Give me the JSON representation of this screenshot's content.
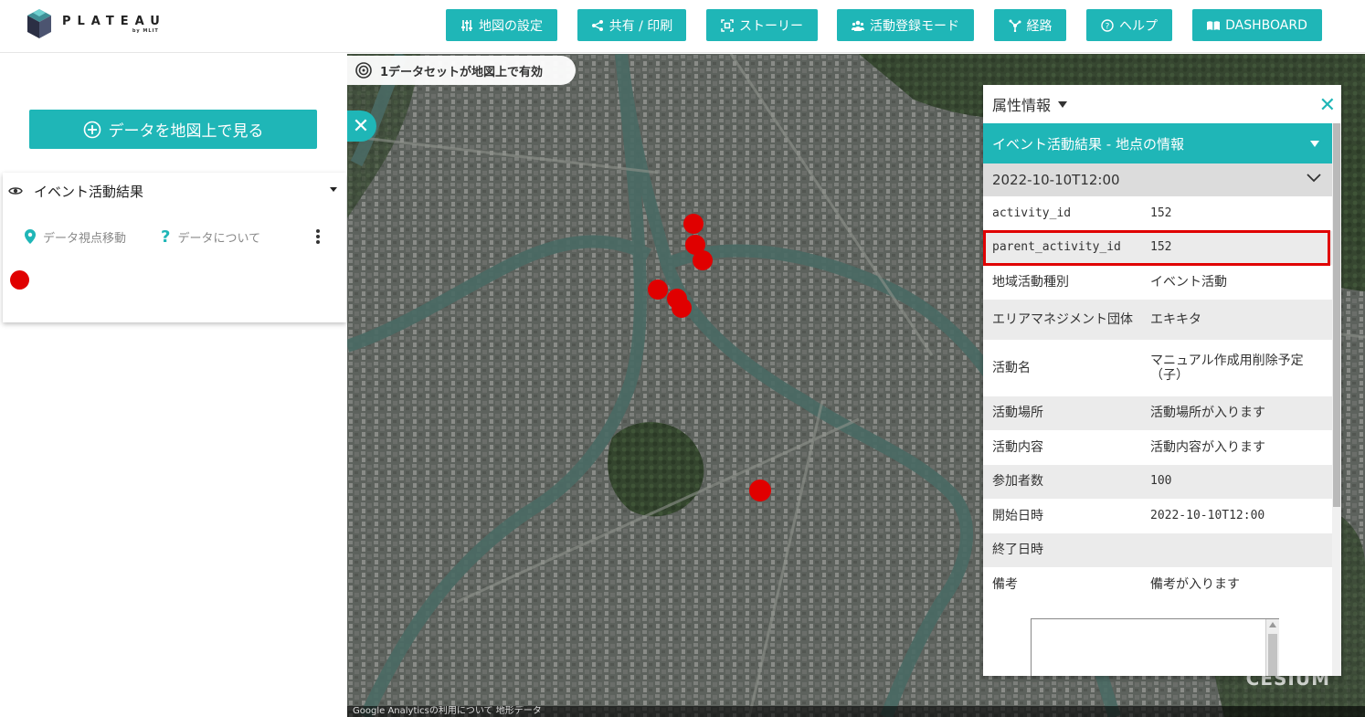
{
  "header": {
    "logo_title": "PLATEAU",
    "logo_sub": "by MLIT",
    "nav": [
      {
        "label": "地図の設定",
        "icon": "sliders-icon"
      },
      {
        "label": "共有 / 印刷",
        "icon": "share-icon"
      },
      {
        "label": "ストーリー",
        "icon": "story-icon"
      },
      {
        "label": "活動登録モード",
        "icon": "people-icon"
      },
      {
        "label": "経路",
        "icon": "route-icon"
      },
      {
        "label": "ヘルプ",
        "icon": "help-circle-icon"
      },
      {
        "label": "DASHBOARD",
        "icon": "book-icon"
      }
    ]
  },
  "left_panel": {
    "add_data_label": "データを地図上で見る",
    "dataset": {
      "title": "イベント活動結果",
      "actions": [
        {
          "label": "データ視点移動",
          "icon": "location-pin-icon"
        },
        {
          "label": "データについて",
          "icon": "question-icon"
        }
      ],
      "legend_color": "#e00000"
    }
  },
  "map": {
    "dataset_status": "1データセットが地図上で有効",
    "attribution": "Google Analyticsの利用について 地形データ",
    "cesium_label": "CESIUM"
  },
  "attribute_panel": {
    "title": "属性情報",
    "layer_title": "イベント活動結果 - 地点の情報",
    "timestamp": "2022-10-10T12:00",
    "rows": [
      {
        "key": "activity_id",
        "value": "152"
      },
      {
        "key": "parent_activity_id",
        "value": "152"
      },
      {
        "key": "地域活動種別",
        "value": "イベント活動"
      },
      {
        "key": "エリアマネジメント団体",
        "value": "エキキタ"
      },
      {
        "key": "活動名",
        "value": "マニュアル作成用削除予定（子）"
      },
      {
        "key": "活動場所",
        "value": "活動場所が入ります"
      },
      {
        "key": "活動内容",
        "value": "活動内容が入ります"
      },
      {
        "key": "参加者数",
        "value": "100"
      },
      {
        "key": "開始日時",
        "value": "2022-10-10T12:00"
      },
      {
        "key": "終了日時",
        "value": ""
      },
      {
        "key": "備考",
        "value": "備考が入ります"
      }
    ]
  },
  "colors": {
    "accent": "#1fb6b7",
    "marker": "#e00000",
    "highlight": "#e00000"
  }
}
